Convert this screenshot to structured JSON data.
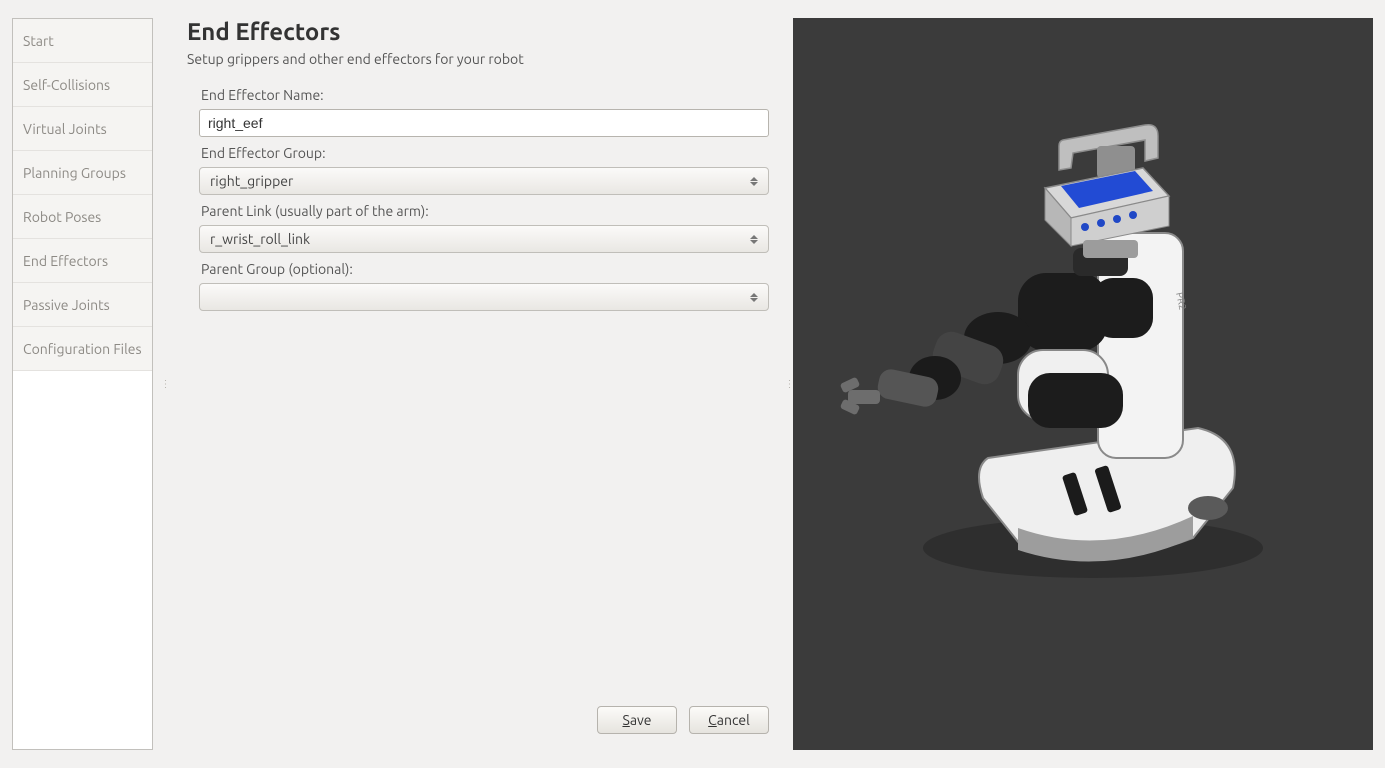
{
  "sidebar": {
    "items": [
      {
        "label": "Start"
      },
      {
        "label": "Self-Collisions"
      },
      {
        "label": "Virtual Joints"
      },
      {
        "label": "Planning Groups"
      },
      {
        "label": "Robot Poses"
      },
      {
        "label": "End Effectors"
      },
      {
        "label": "Passive Joints"
      },
      {
        "label": "Configuration Files"
      }
    ]
  },
  "page": {
    "title": "End Effectors",
    "subtitle": "Setup grippers and other end effectors for your robot"
  },
  "form": {
    "name_label": "End Effector Name:",
    "name_value": "right_eef",
    "group_label": "End Effector Group:",
    "group_value": "right_gripper",
    "parent_link_label": "Parent Link (usually part of the arm):",
    "parent_link_value": "r_wrist_roll_link",
    "parent_group_label": "Parent Group (optional):",
    "parent_group_value": ""
  },
  "buttons": {
    "save": "Save",
    "cancel": "Cancel"
  }
}
